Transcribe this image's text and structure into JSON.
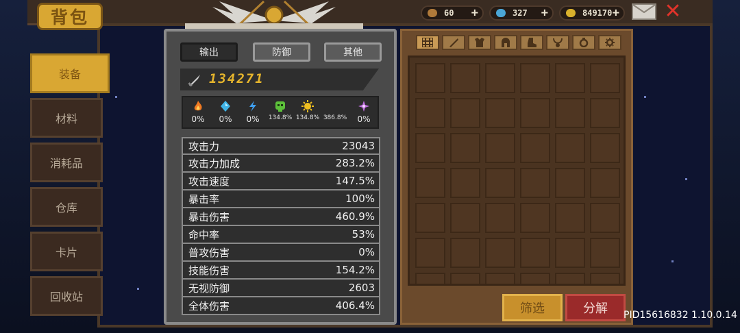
{
  "title": "背包",
  "currency": [
    {
      "icon": "potion-icon",
      "value": "60",
      "color": "#b07a3a"
    },
    {
      "icon": "gem-icon",
      "value": "327",
      "color": "#4aa6d6"
    },
    {
      "icon": "gold-coin-icon",
      "value": "849170",
      "color": "#d9b12c"
    }
  ],
  "left_tabs": [
    "装备",
    "材料",
    "消耗品",
    "仓库",
    "卡片",
    "回收站"
  ],
  "stat_tabs": [
    "输出",
    "防御",
    "其他"
  ],
  "power": "134271",
  "elements": [
    {
      "icon": "fire-icon",
      "value": "0%",
      "color": "#f07a22"
    },
    {
      "icon": "ice-crystal-icon",
      "value": "0%",
      "color": "#3fb4e6"
    },
    {
      "icon": "lightning-icon",
      "value": "0%",
      "color": "#3fa0f0"
    },
    {
      "icon": "poison-skull-icon",
      "value": "134.8%",
      "color": "#5cc03a"
    },
    {
      "icon": "sun-light-icon",
      "value": "134.8%",
      "color": "#f0c020"
    },
    {
      "icon": "dark-moon-icon",
      "value": "386.8%",
      "color": "#c0203a"
    },
    {
      "icon": "arcane-star-icon",
      "value": "0%",
      "color": "#c070e0"
    }
  ],
  "stats": [
    {
      "label": "攻击力",
      "value": "23043"
    },
    {
      "label": "攻击力加成",
      "value": "283.2%"
    },
    {
      "label": "攻击速度",
      "value": "147.5%"
    },
    {
      "label": "暴击率",
      "value": "100%"
    },
    {
      "label": "暴击伤害",
      "value": "460.9%"
    },
    {
      "label": "命中率",
      "value": "53%"
    },
    {
      "label": "普攻伤害",
      "value": "0%"
    },
    {
      "label": "技能伤害",
      "value": "154.2%"
    },
    {
      "label": "无视防御",
      "value": "2603"
    },
    {
      "label": "全体伤害",
      "value": "406.4%"
    }
  ],
  "inventory_tabs": [
    "all-grid-icon",
    "sword-icon",
    "armor-icon",
    "helmet-icon",
    "boots-icon",
    "necklace-icon",
    "ring-icon",
    "gear-icon"
  ],
  "buttons": {
    "filter": "筛选",
    "decompose": "分解"
  },
  "pid": "PID15616832 1.10.0.14"
}
